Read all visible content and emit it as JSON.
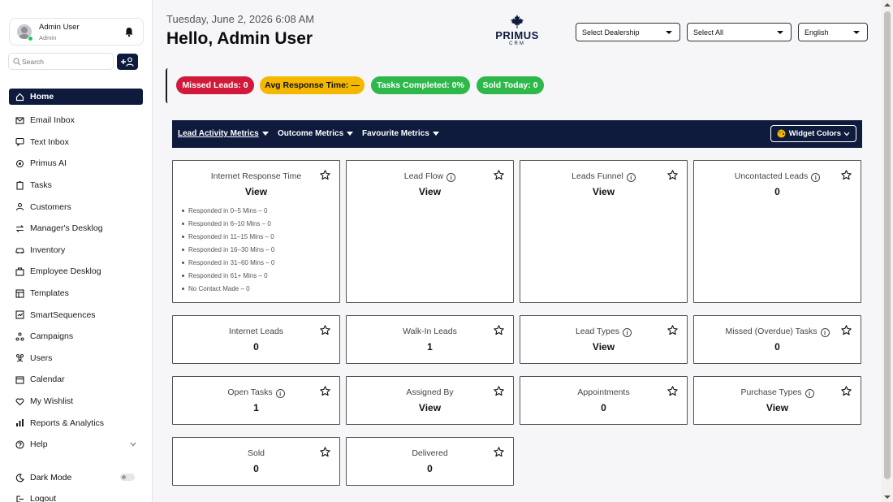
{
  "user": {
    "name": "Admin User",
    "role": "Admin"
  },
  "search": {
    "placeholder": "Search"
  },
  "nav": [
    {
      "label": "Home",
      "icon": "home-icon"
    },
    {
      "label": "Email Inbox",
      "icon": "mail-icon"
    },
    {
      "label": "Text Inbox",
      "icon": "message-icon"
    },
    {
      "label": "Primus AI",
      "icon": "ai-icon"
    },
    {
      "label": "Tasks",
      "icon": "clipboard-icon"
    },
    {
      "label": "Customers",
      "icon": "users-icon"
    },
    {
      "label": "Manager's Desklog",
      "icon": "transfer-icon"
    },
    {
      "label": "Inventory",
      "icon": "car-icon"
    },
    {
      "label": "Employee Desklog",
      "icon": "briefcase-icon"
    },
    {
      "label": "Templates",
      "icon": "template-icon"
    },
    {
      "label": "SmartSequences",
      "icon": "sequence-icon"
    },
    {
      "label": "Campaigns",
      "icon": "campaign-icon"
    },
    {
      "label": "Users",
      "icon": "team-icon"
    },
    {
      "label": "Calendar",
      "icon": "calendar-icon"
    },
    {
      "label": "My Wishlist",
      "icon": "heart-icon"
    },
    {
      "label": "Reports & Analytics",
      "icon": "chart-icon"
    },
    {
      "label": "Help",
      "icon": "help-icon"
    }
  ],
  "dark_mode_label": "Dark Mode",
  "logout_label": "Logout",
  "header": {
    "datetime": "Tuesday, June 2, 2026  6:08 AM",
    "greeting": "Hello, Admin User",
    "logo_word": "PRIMUS",
    "logo_sub": "CRM"
  },
  "selects": {
    "dealership": "Select Dealership",
    "scope": "Select All",
    "language": "English"
  },
  "badges": [
    {
      "label": "Missed Leads: 0",
      "bg": "#d11a3a",
      "fg": "#ffffff"
    },
    {
      "label": "Avg Response Time: —",
      "bg": "#f5b800",
      "fg": "#111111"
    },
    {
      "label": "Tasks Completed: 0%",
      "bg": "#2eb84a",
      "fg": "#ffffff"
    },
    {
      "label": "Sold Today: 0",
      "bg": "#2eb84a",
      "fg": "#ffffff"
    }
  ],
  "metric_tabs": [
    "Lead Activity Metrics",
    "Outcome Metrics",
    "Favourite Metrics"
  ],
  "widget_colors_label": "Widget Colors",
  "response_list": [
    "Responded in 0–5 Mins – 0",
    "Responded in 6–10 Mins – 0",
    "Responded in 11–15 Mins – 0",
    "Responded in 16–30 Mins – 0",
    "Responded in 31–60 Mins – 0",
    "Responded in 61+ Mins – 0",
    "No Contact Made – 0"
  ],
  "cards": [
    {
      "title": "Internet Response Time",
      "value": "View",
      "info": false
    },
    {
      "title": "Lead Flow",
      "value": "View",
      "info": true
    },
    {
      "title": "Leads Funnel",
      "value": "View",
      "info": true
    },
    {
      "title": "Uncontacted Leads",
      "value": "0",
      "info": true
    },
    {
      "title": "Internet Leads",
      "value": "0",
      "info": false
    },
    {
      "title": "Walk-In Leads",
      "value": "1",
      "info": false
    },
    {
      "title": "Lead Types",
      "value": "View",
      "info": true
    },
    {
      "title": "Missed (Overdue) Tasks",
      "value": "0",
      "info": true
    },
    {
      "title": "Open Tasks",
      "value": "1",
      "info": true
    },
    {
      "title": "Assigned By",
      "value": "View",
      "info": false
    },
    {
      "title": "Appointments",
      "value": "0",
      "info": false
    },
    {
      "title": "Purchase Types",
      "value": "View",
      "info": true
    },
    {
      "title": "Sold",
      "value": "0",
      "info": false
    },
    {
      "title": "Delivered",
      "value": "0",
      "info": false
    }
  ],
  "colors": {
    "navy": "#0f1b3d",
    "online": "#22c55e"
  }
}
